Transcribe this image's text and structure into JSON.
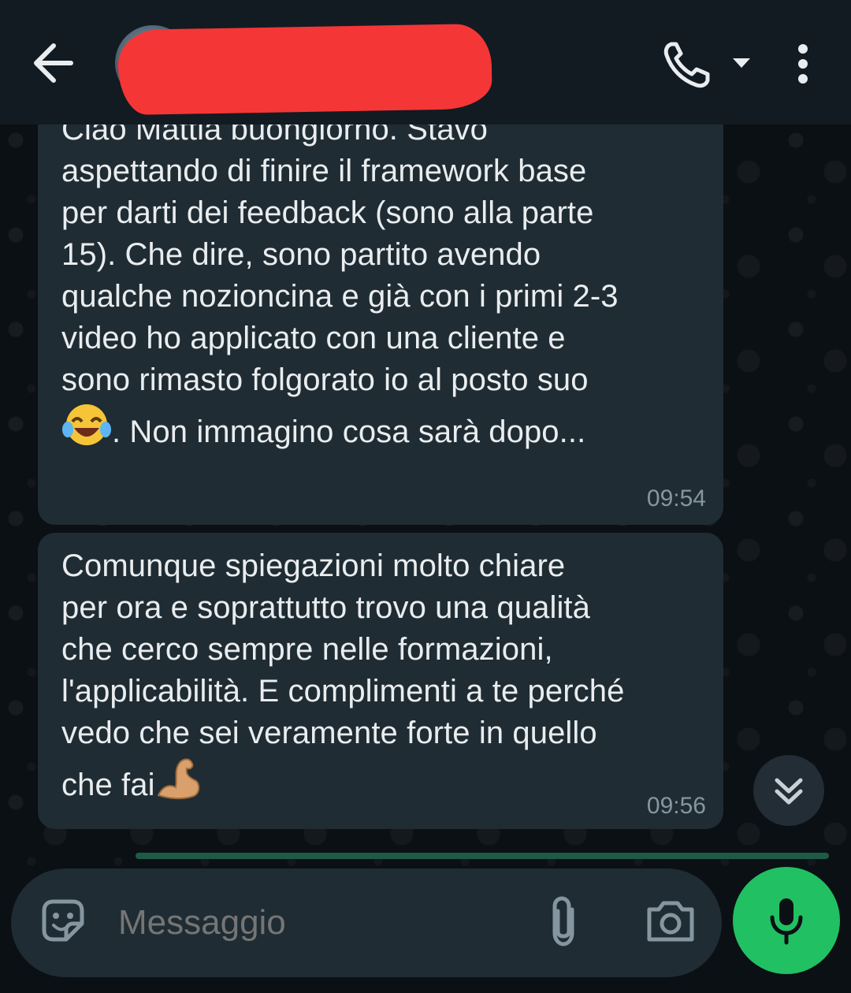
{
  "header": {
    "contact_name": "",
    "icons": [
      "back-arrow-icon",
      "phone-icon",
      "dropdown-caret-icon",
      "more-vertical-icon"
    ]
  },
  "messages": [
    {
      "text_part1": "Ciao Mattia buongiorno. Stavo\naspettando di finire il framework base\nper darti dei feedback (sono alla parte\n15). Che dire, sono partito avendo\nqualche nozioncina e già con i primi 2-3\nvideo ho applicato con una cliente e\nsono rimasto folgorato io al posto suo",
      "emoji": "face-with-tears-of-joy",
      "text_part2": ". Non immagino cosa sarà dopo...",
      "time": "09:54"
    },
    {
      "text_part1": "Comunque spiegazioni molto chiare\nper ora e soprattutto trovo una qualità\nche cerco sempre nelle formazioni,\nl'applicabilità. E complimenti a te perché\nvedo che sei veramente forte in quello\nche fai",
      "emoji": "flexed-biceps",
      "time": "09:56"
    }
  ],
  "composer": {
    "placeholder": "Messaggio",
    "icons": [
      "sticker-icon",
      "paperclip-icon",
      "camera-icon",
      "microphone-icon"
    ]
  },
  "colors": {
    "header_bg": "#121b22",
    "bubble_bg": "#202c33",
    "accent_green": "#21c063",
    "redaction": "#f53636"
  }
}
